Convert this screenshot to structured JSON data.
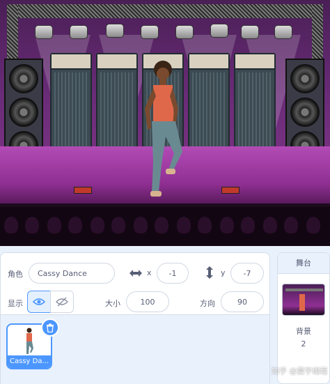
{
  "sprite_info": {
    "sprite_label": "角色",
    "sprite_name": "Cassy Dance",
    "x_label": "x",
    "x_value": "-1",
    "y_label": "y",
    "y_value": "-7",
    "show_label": "显示",
    "size_label": "大小",
    "size_value": "100",
    "direction_label": "方向",
    "direction_value": "90"
  },
  "sprites": [
    {
      "name": "Cassy Da..."
    }
  ],
  "stage_panel": {
    "title": "舞台",
    "backdrops_label": "背景",
    "backdrops_count": "2"
  },
  "watermark": "知乎 @震宇编程",
  "colors": {
    "accent": "#4c97ff",
    "panel_text": "#575e75",
    "background": "#e9f1fc"
  },
  "icons": {
    "x_arrow": "horizontal-arrows-icon",
    "y_arrow": "vertical-arrows-icon",
    "show": "eye-icon",
    "hide": "eye-slash-icon",
    "delete": "trash-icon"
  }
}
